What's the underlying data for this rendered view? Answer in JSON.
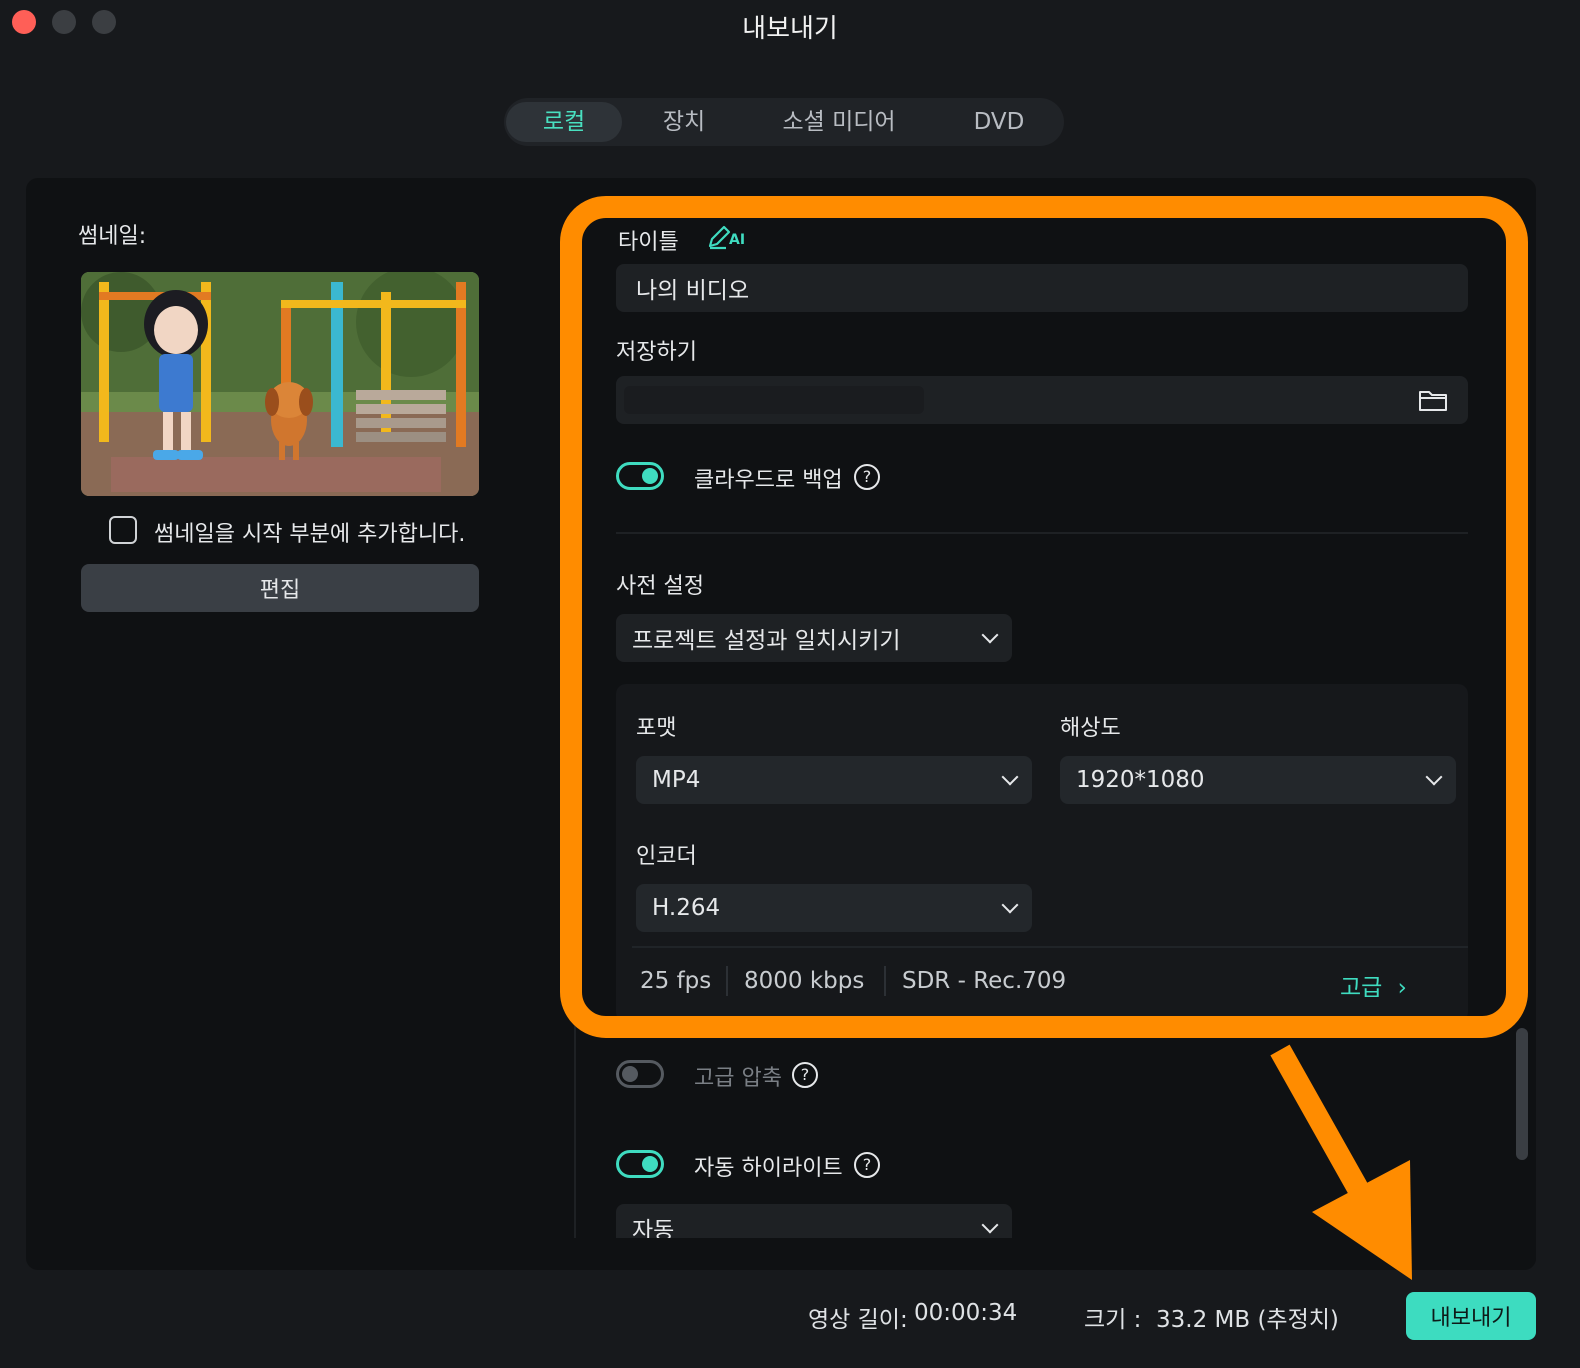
{
  "window": {
    "title": "내보내기"
  },
  "tabs": [
    {
      "label": "로컬",
      "active": true
    },
    {
      "label": "장치",
      "active": false
    },
    {
      "label": "소셜 미디어",
      "active": false
    },
    {
      "label": "DVD",
      "active": false
    }
  ],
  "left": {
    "thumbnail_label": "썸네일:",
    "add_to_start_label": "썸네일을 시작 부분에 추가합니다.",
    "add_to_start_checked": false,
    "edit_button": "편집"
  },
  "right": {
    "title_label": "타이틀",
    "ai_badge": "AI",
    "title_value": "나의 비디오",
    "save_label": "저장하기",
    "cloud_backup_label": "클라우드로 백업",
    "cloud_backup_on": true,
    "preset_label": "사전 설정",
    "preset_value": "프로젝트 설정과 일치시키기",
    "format_label": "포맷",
    "format_value": "MP4",
    "resolution_label": "해상도",
    "resolution_value": "1920*1080",
    "encoder_label": "인코더",
    "encoder_value": "H.264",
    "fps": "25 fps",
    "bitrate": "8000 kbps",
    "color": "SDR - Rec.709",
    "advanced_link": "고급",
    "advanced_compression_label": "고급 압축",
    "advanced_compression_on": false,
    "auto_highlight_label": "자동 하이라이트",
    "auto_highlight_on": true,
    "auto_highlight_value": "자동"
  },
  "footer": {
    "duration_label": "영상 길이:",
    "duration_value": "00:00:34",
    "size_label": "크기 :",
    "size_value": "33.2 MB (추정치)",
    "export_button": "내보내기"
  },
  "colors": {
    "accent": "#3ddcc0",
    "highlight": "#ff8c00",
    "background": "#17191c",
    "panel": "#0f1113"
  }
}
